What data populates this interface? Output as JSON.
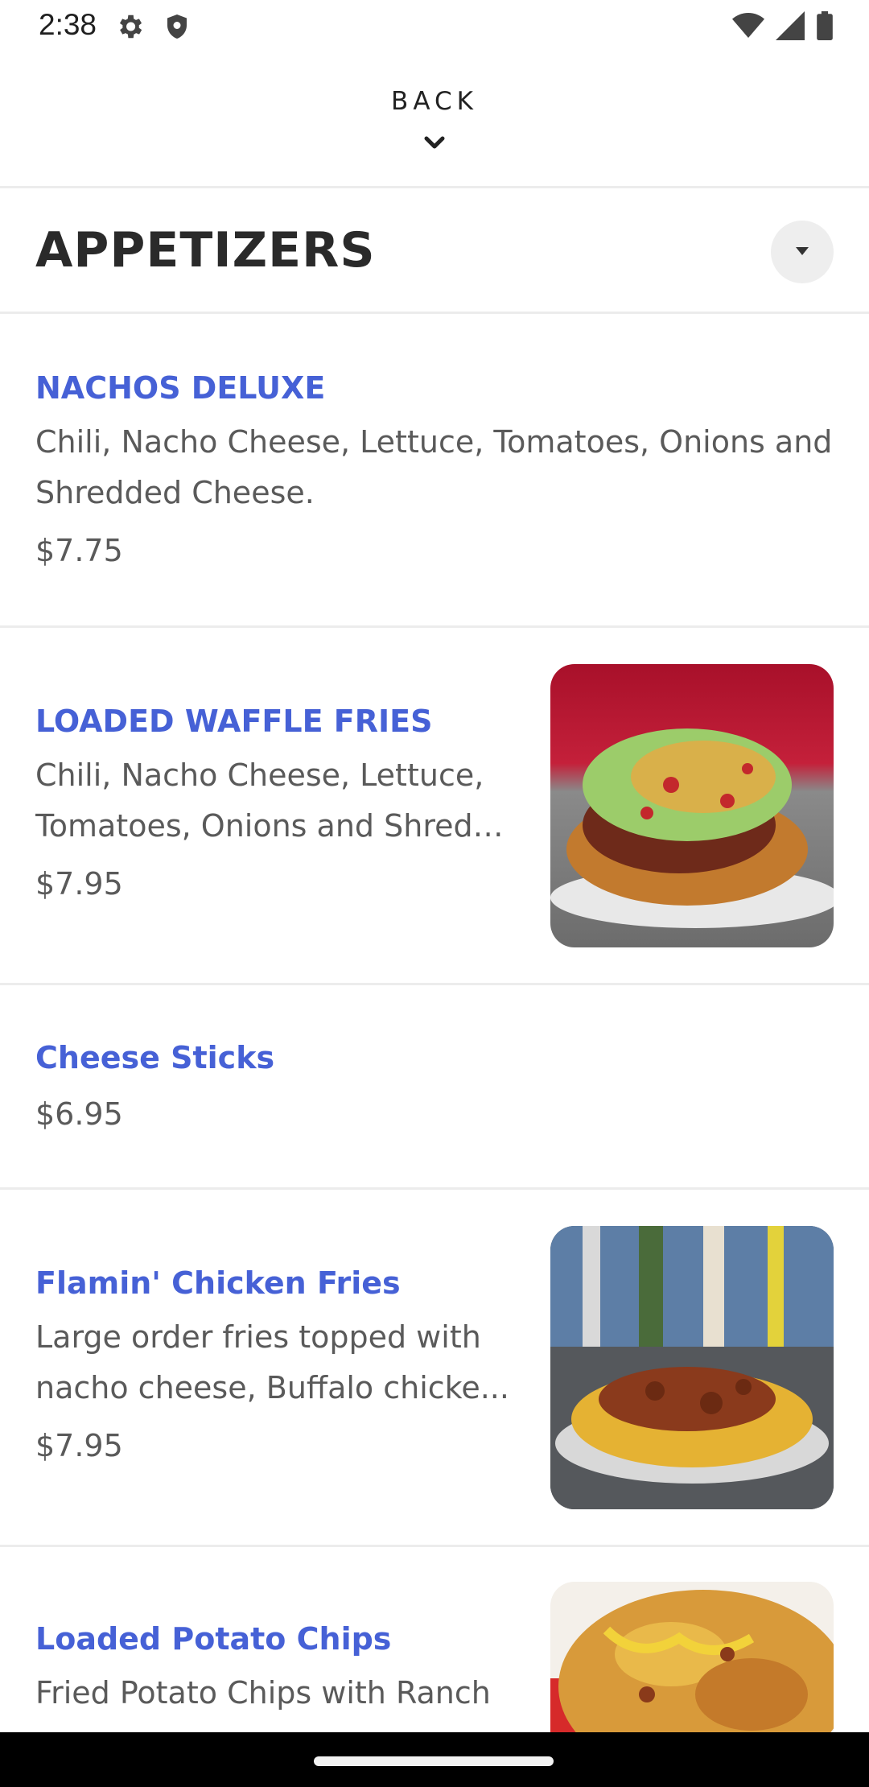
{
  "status_bar": {
    "time": "2:38",
    "icons_left": [
      "gear-icon",
      "shield-icon"
    ],
    "icons_right": [
      "wifi-icon",
      "signal-icon",
      "battery-icon"
    ]
  },
  "back": {
    "label": "BACK",
    "icon": "chevron-down-icon"
  },
  "section": {
    "title": "APPETIZERS",
    "dropdown_icon": "caret-down-icon"
  },
  "items": [
    {
      "name": "NACHOS DELUXE",
      "description_line1": "Chili, Nacho Cheese, Lettuce, Tomatoes, Onions and",
      "description_line2": "Shredded Cheese.",
      "price": "$7.75"
    },
    {
      "name": "LOADED WAFFLE FRIES",
      "description_line1": "Chili, Nacho Cheese, Lettuce,",
      "description_line2": "Tomatoes, Onions and Shredd...",
      "price": "$7.95",
      "photo": "loaded-waffle-fries-photo"
    },
    {
      "name": "Cheese Sticks",
      "price": "$6.95"
    },
    {
      "name": "Flamin'  Chicken Fries",
      "description_line1": "Large order fries topped with",
      "description_line2": "nacho cheese, Buffalo chicke...",
      "price": "$7.95",
      "photo": "chicken-fries-photo"
    },
    {
      "name": "Loaded Potato Chips",
      "description_line1": "Fried Potato Chips with Ranch",
      "photo": "potato-chips-photo"
    }
  ],
  "colors": {
    "item_name": "#4661d6",
    "text": "#5a5a5a",
    "divider": "#ececec"
  }
}
